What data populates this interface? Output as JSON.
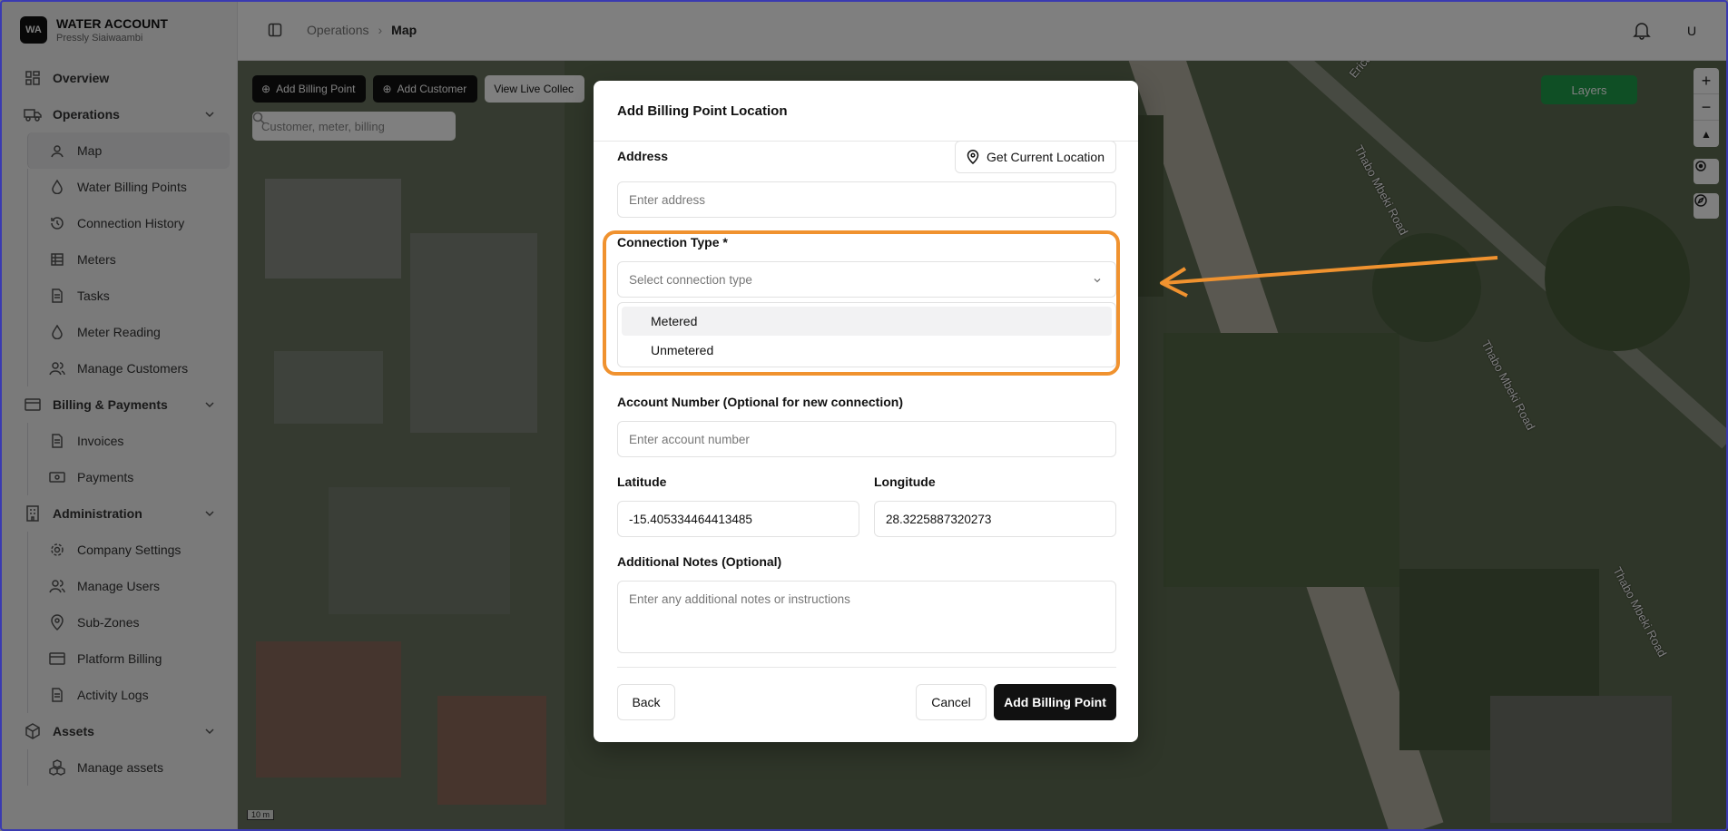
{
  "brand": {
    "logo": "WA",
    "title": "WATER ACCOUNT",
    "subtitle": "Pressly Siaiwaambi"
  },
  "sidebar": {
    "overview": "Overview",
    "operations": "Operations",
    "operations_items": [
      "Map",
      "Water Billing Points",
      "Connection History",
      "Meters",
      "Tasks",
      "Meter Reading",
      "Manage Customers"
    ],
    "billing": "Billing & Payments",
    "billing_items": [
      "Invoices",
      "Payments"
    ],
    "administration": "Administration",
    "administration_items": [
      "Company Settings",
      "Manage Users",
      "Sub-Zones",
      "Platform Billing",
      "Activity Logs"
    ],
    "assets": "Assets",
    "assets_items": [
      "Manage assets"
    ]
  },
  "topbar": {
    "crumb_parent": "Operations",
    "crumb_current": "Map",
    "avatar": "U"
  },
  "map": {
    "btn_add_billing": "Add Billing Point",
    "btn_add_customer": "Add Customer",
    "btn_live": "View Live Collec",
    "search_placeholder": "Customer, meter, billing",
    "layers": "Layers",
    "scale": "10 m",
    "road_1": "Thabo Mbeki Road",
    "road_2": "Thabo Mbeki Road",
    "road_3": "Thabo Mbeki Road",
    "road_4": "Erica"
  },
  "modal": {
    "title": "Add Billing Point Location",
    "address_label": "Address",
    "get_location": "Get Current Location",
    "address_placeholder": "Enter address",
    "connection_label": "Connection Type *",
    "connection_placeholder": "Select connection type",
    "options": [
      "Metered",
      "Unmetered"
    ],
    "account_label": "Account Number (Optional for new connection)",
    "account_placeholder": "Enter account number",
    "latitude_label": "Latitude",
    "latitude_value": "-15.405334464413485",
    "longitude_label": "Longitude",
    "longitude_value": "28.3225887320273",
    "notes_label": "Additional Notes (Optional)",
    "notes_placeholder": "Enter any additional notes or instructions",
    "back": "Back",
    "cancel": "Cancel",
    "submit": "Add Billing Point"
  },
  "colors": {
    "highlight": "#f0922f",
    "layers_green": "#1e9e4a",
    "primary": "#111111"
  }
}
